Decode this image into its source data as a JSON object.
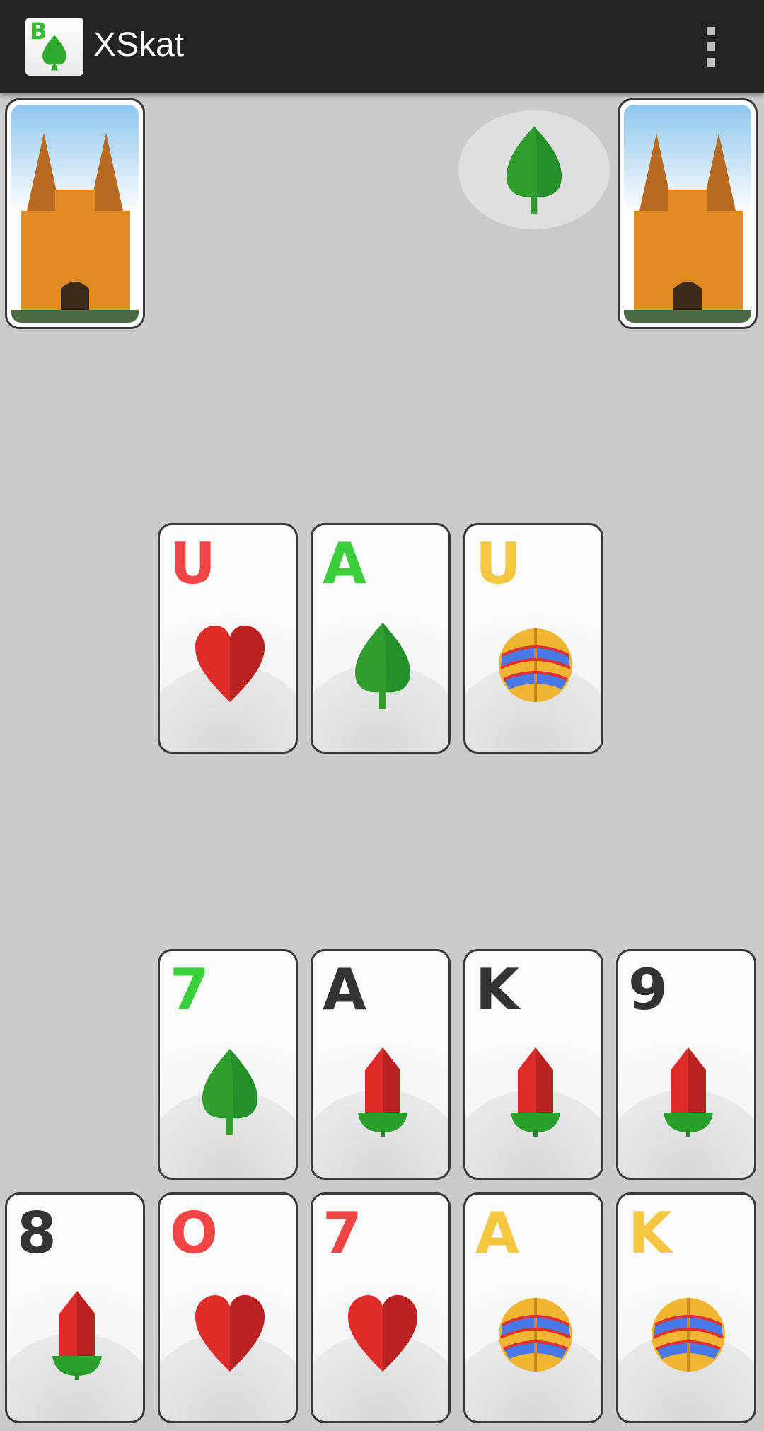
{
  "app": {
    "title": "XSkat",
    "icon_letter": "B"
  },
  "trump_indicator": {
    "suit": "green",
    "icon": "leaf-icon"
  },
  "colors": {
    "red": "#f04545",
    "green": "#3bcf3b",
    "yellow": "#f5c640",
    "black": "#333333"
  },
  "trick_cards": [
    {
      "rank": "U",
      "suit": "hearts"
    },
    {
      "rank": "A",
      "suit": "leaves"
    },
    {
      "rank": "U",
      "suit": "bells"
    }
  ],
  "hand_row_1": [
    {
      "rank": "7",
      "suit": "leaves"
    },
    {
      "rank": "A",
      "suit": "acorns"
    },
    {
      "rank": "K",
      "suit": "acorns"
    },
    {
      "rank": "9",
      "suit": "acorns"
    }
  ],
  "hand_row_2": [
    {
      "rank": "8",
      "suit": "acorns"
    },
    {
      "rank": "O",
      "suit": "hearts"
    },
    {
      "rank": "7",
      "suit": "hearts"
    },
    {
      "rank": "A",
      "suit": "bells"
    },
    {
      "rank": "K",
      "suit": "bells"
    }
  ]
}
